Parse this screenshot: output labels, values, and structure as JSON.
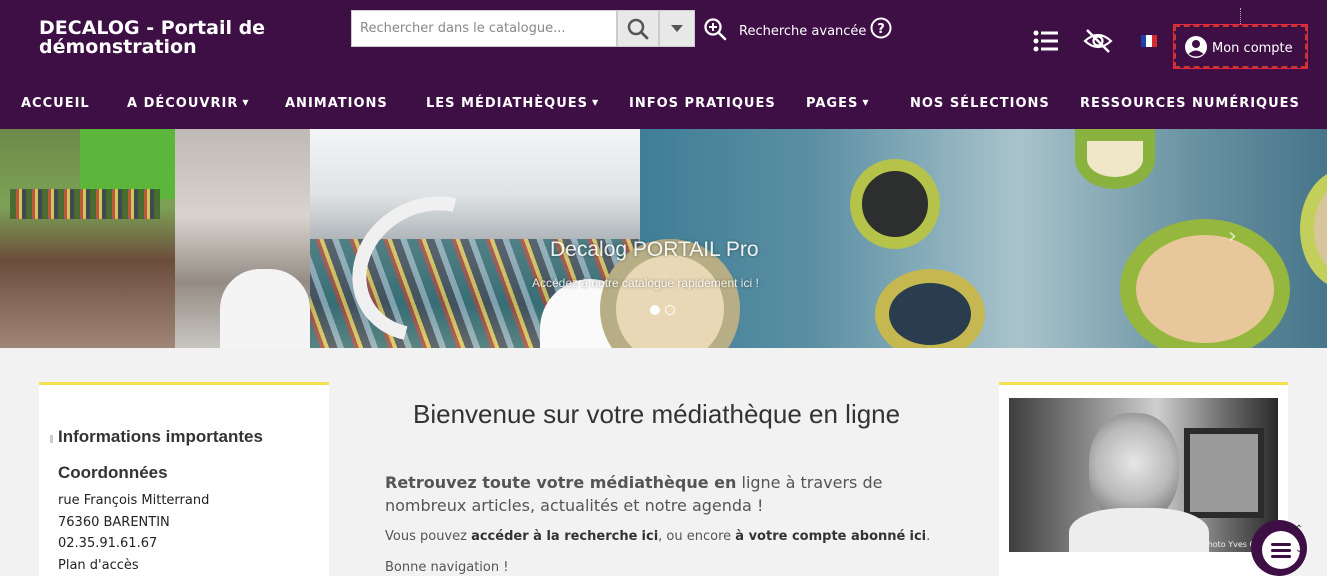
{
  "header": {
    "brand": "DECALOG - Portail de démonstration",
    "search_placeholder": "Rechercher dans le catalogue...",
    "advanced_search": "Recherche avancée",
    "account_label": "Mon compte"
  },
  "nav": [
    {
      "label": "ACCUEIL",
      "dropdown": false
    },
    {
      "label": "A DÉCOUVRIR",
      "dropdown": true
    },
    {
      "label": "ANIMATIONS",
      "dropdown": false
    },
    {
      "label": "LES MÉDIATHÈQUES",
      "dropdown": true
    },
    {
      "label": "INFOS PRATIQUES",
      "dropdown": false
    },
    {
      "label": "PAGES",
      "dropdown": true
    },
    {
      "label": "NOS SÉLECTIONS",
      "dropdown": false
    },
    {
      "label": "RESSOURCES NUMÉRIQUES",
      "dropdown": false
    }
  ],
  "banner": {
    "title": "Decalog PORTAIL Pro",
    "subtitle": "Accédez à notre catalogue rapidement ici !",
    "slides": 2,
    "active_slide": 1
  },
  "left_panel": {
    "heading": "Informations importantes",
    "subheading": "Coordonnées",
    "lines": [
      "rue François Mitterrand",
      "76360 BARENTIN",
      "02.35.91.61.67",
      "Plan d'accès"
    ]
  },
  "main": {
    "title": "Bienvenue sur votre médiathèque en ligne",
    "intro_bold": "Retrouvez toute votre médiathèque en",
    "intro_rest": " ligne à travers de nombreux articles, actualités et notre agenda !",
    "p2_a": "Vous pouvez ",
    "p2_b": "accéder à la recherche",
    "p2_c": " ",
    "p2_d": "ici",
    "p2_e": ", ou encore ",
    "p2_f": "à votre compte abonné",
    "p2_g": " ",
    "p2_h": "ici",
    "p2_i": ".",
    "p3": "Bonne navigation !"
  },
  "right_panel": {
    "photo_credit": "Photo Yves Quent"
  },
  "colors": {
    "header_bg": "#3d0f45",
    "accent_yellow": "#f4e14e",
    "account_border": "#c0392b"
  }
}
